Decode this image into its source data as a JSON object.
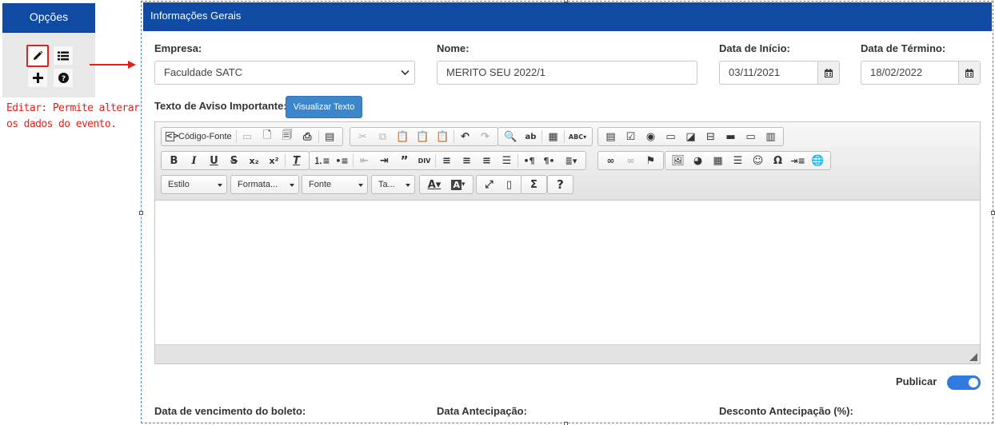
{
  "options_panel": {
    "title": "Opções",
    "buttons": [
      {
        "name": "edit",
        "icon": "pencil-icon"
      },
      {
        "name": "list",
        "icon": "list-icon"
      },
      {
        "name": "add",
        "icon": "plus-icon"
      },
      {
        "name": "help",
        "icon": "question-circle-icon"
      }
    ]
  },
  "annotation": {
    "text": "Editar: Permite alterar os dados do evento.",
    "color": "#e0221b"
  },
  "panel": {
    "title": "Informações Gerais",
    "header_color": "#0f4aa3"
  },
  "form": {
    "empresa": {
      "label": "Empresa:",
      "value": "Faculdade SATC"
    },
    "nome": {
      "label": "Nome:",
      "value": "MERITO SEU 2022/1"
    },
    "data_inicio": {
      "label": "Data de Início:",
      "value": "03/11/2021"
    },
    "data_termino": {
      "label": "Data de Término:",
      "value": "18/02/2022"
    },
    "aviso": {
      "label": "Texto de Aviso Importante:",
      "button": "Visualizar Texto"
    },
    "publicar": {
      "label": "Publicar",
      "checked": true
    },
    "vencimento": {
      "label": "Data de vencimento do boleto:"
    },
    "antecipacao": {
      "label": "Data Antecipação:"
    },
    "desconto": {
      "label": "Desconto Antecipação (%):"
    }
  },
  "editor": {
    "source_label": "Código-Fonte",
    "combos": {
      "estilo": "Estilo",
      "formatacao": "Formata...",
      "fonte": "Fonte",
      "tamanho": "Ta..."
    }
  }
}
